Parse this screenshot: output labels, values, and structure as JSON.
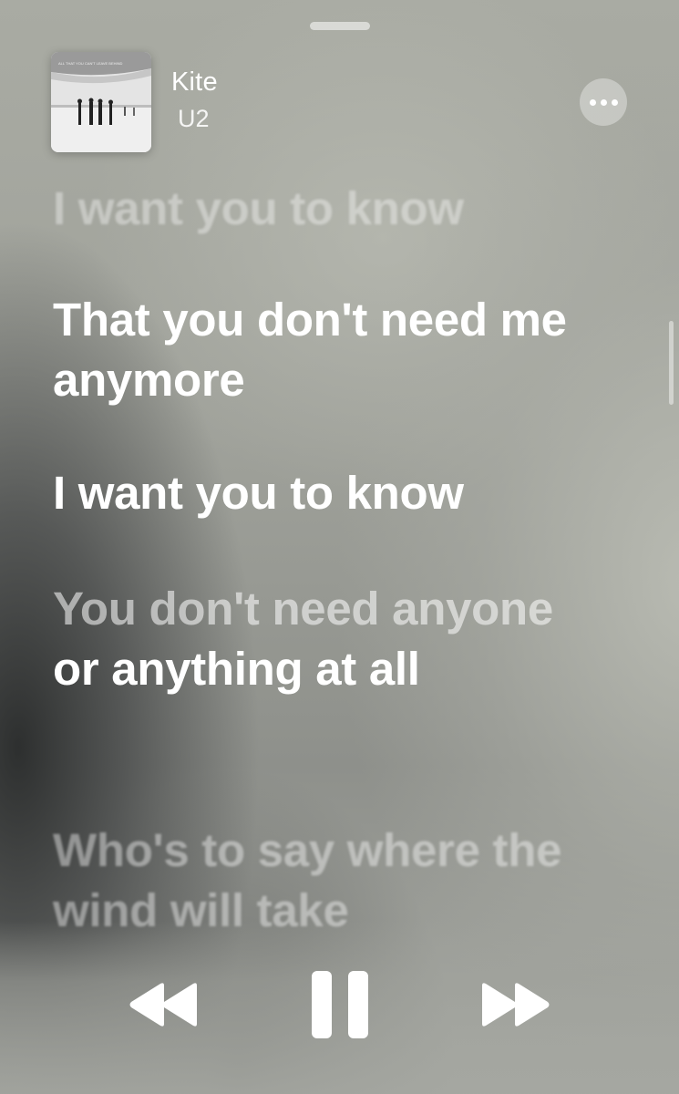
{
  "now_playing": {
    "title": "Kite",
    "artist": "U2",
    "album_art_text": "ALL THAT YOU CAN'T LEAVE BEHIND"
  },
  "lyrics": {
    "past_line": "I want you to know",
    "line_1": {
      "text": "That you don't need me anymore"
    },
    "line_2": "I want you to know",
    "line_3": {
      "sung": "You don't need anyone",
      "unsung": " or anything at all"
    },
    "upcoming_line": "Who's to say where the wind will take"
  },
  "controls": {
    "previous_icon": "rewind-icon",
    "play_pause_icon": "pause-icon",
    "next_icon": "fast-forward-icon",
    "more_icon": "ellipsis-icon"
  },
  "colors": {
    "active_lyric": "#ffffff",
    "background": "#a5a79f"
  }
}
